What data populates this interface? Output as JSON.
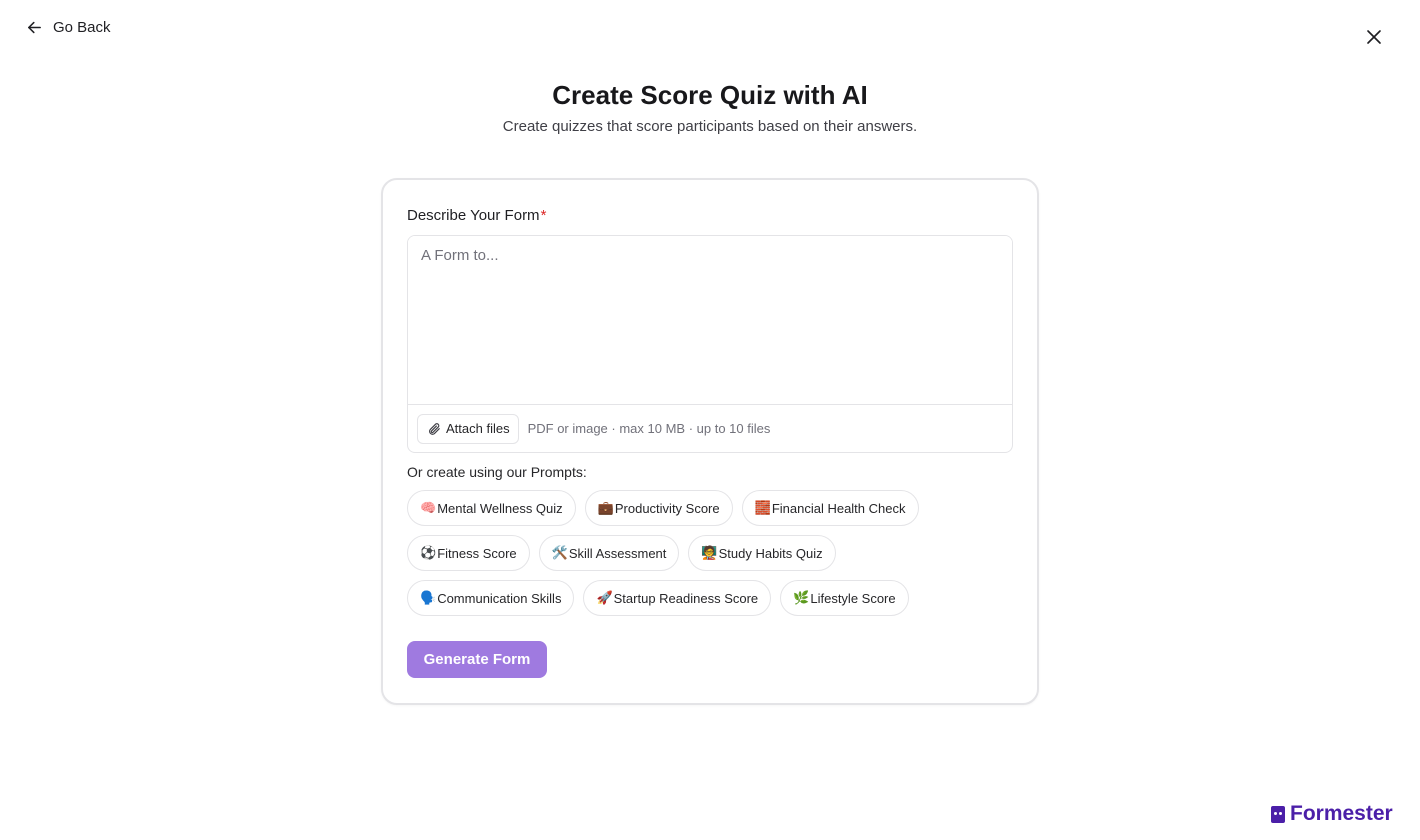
{
  "header": {
    "back_label": "Go Back"
  },
  "title": "Create Score Quiz with AI",
  "subtitle": "Create quizzes that score participants based on their answers.",
  "form": {
    "label": "Describe Your Form",
    "required_mark": "*",
    "placeholder": "A Form to...",
    "value": "",
    "attach_label": "Attach files",
    "attach_hint": "PDF or image · max 10 MB · up to 10 files"
  },
  "prompts": {
    "label": "Or create using our Prompts:",
    "rows": [
      [
        {
          "emoji": "🧠",
          "label": "Mental Wellness Quiz"
        },
        {
          "emoji": "💼",
          "label": "Productivity Score"
        },
        {
          "emoji": "🧱",
          "label": "Financial Health Check"
        }
      ],
      [
        {
          "emoji": "⚽",
          "label": "Fitness Score"
        },
        {
          "emoji": "🛠️",
          "label": "Skill Assessment"
        },
        {
          "emoji": "🧑‍🏫",
          "label": "Study Habits Quiz"
        }
      ],
      [
        {
          "emoji": "🗣️",
          "label": "Communication Skills"
        },
        {
          "emoji": "🚀",
          "label": "Startup Readiness Score"
        },
        {
          "emoji": "🌿",
          "label": "Lifestyle Score"
        }
      ]
    ]
  },
  "generate_label": "Generate Form",
  "brand": {
    "name": "Formester",
    "color": "#4b1fa8"
  },
  "accent_color": "#9f7ae0",
  "icons": {
    "back": "arrow-left-icon",
    "close": "close-icon",
    "attach": "paperclip-icon"
  }
}
